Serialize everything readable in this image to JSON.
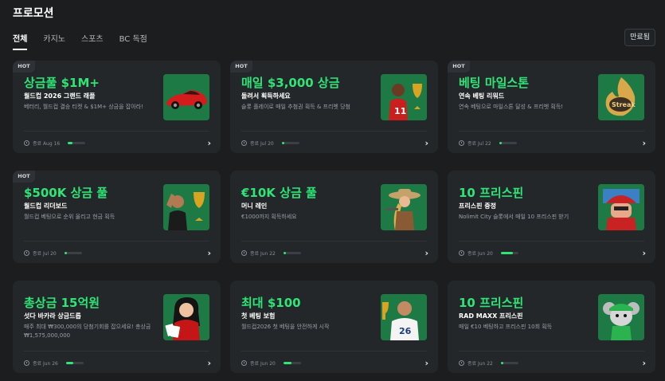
{
  "header": {
    "title": "프로모션"
  },
  "tabs": [
    {
      "label": "전체",
      "active": true
    },
    {
      "label": "카지노",
      "active": false
    },
    {
      "label": "스포츠",
      "active": false
    },
    {
      "label": "BC 독점",
      "active": false
    }
  ],
  "ended_button": "만료됨",
  "accent_color": "#2ee576",
  "cards": [
    {
      "hot": "HOT",
      "headline": "상금풀 $1M+",
      "subtitle": "월드컵 2026 그랜드 래플",
      "desc": "베터리, 월드컵 결승 티켓 & $1M+ 상금을 잡아라!",
      "end": "종료 Aug 16",
      "progress": 0.25,
      "icon": "red-sports-car-icon"
    },
    {
      "hot": "HOT",
      "headline": "매일 $3,000 상금",
      "subtitle": "돌려서 획득하세요",
      "desc": "슬롯 플레이로 매일 추첨권 획득 & 프리벳 당첨",
      "end": "종료 Jul 20",
      "progress": 0.15,
      "icon": "soccer-player-trophy-icon"
    },
    {
      "hot": "HOT",
      "headline": "베팅 마일스톤",
      "subtitle": "연속 베팅 리워드",
      "desc": "연속 베팅으로 마일스톤 달성 & 프리벳 획득!",
      "end": "종료 Jul 22",
      "progress": 0.15,
      "icon": "streak-badge-icon"
    },
    {
      "hot": "HOT",
      "headline": "$500K 상금 풀",
      "subtitle": "월드컵 리더보드",
      "desc": "월드컵 베팅으로 순위 올리고 현금 획득",
      "end": "종료 Jul 20",
      "progress": 0.15,
      "icon": "cheering-fan-trophy-icon"
    },
    {
      "hot": "",
      "headline": "€10K 상금 풀",
      "subtitle": "머니 레인",
      "desc": "€1000까지 획득하세요",
      "end": "종료 Jun 22",
      "progress": 0.15,
      "icon": "cowgirl-gunslinger-icon"
    },
    {
      "hot": "",
      "headline": "10 프리스핀",
      "subtitle": "프리스핀 증정",
      "desc": "Nolimit City 슬롯에서 매일 10 프리스핀 받기",
      "end": "종료 Jun 20",
      "progress": 0.7,
      "icon": "red-cap-character-icon"
    },
    {
      "hot": "",
      "headline": "총상금 15억원",
      "subtitle": "섯다 바카라 상금드롭",
      "desc": "매주 최대 ₩300,000의 당첨기회를 잡으세요! 총상금 ₩1,575,000,000",
      "end": "종료 Jun 26",
      "progress": 0.4,
      "icon": "card-dealer-woman-icon"
    },
    {
      "hot": "",
      "headline": "최대 $100",
      "subtitle": "첫 베팅 보험",
      "desc": "월드컵2026 첫 베팅을 안전하게 시작",
      "end": "종료 Jun 20",
      "progress": 0.45,
      "icon": "soccer-player-26-icon"
    },
    {
      "hot": "",
      "headline": "10 프리스핀",
      "subtitle": "RAD MAXX 프리스핀",
      "desc": "매일 €10 베팅하고 프리스핀 10회 획득",
      "end": "종료 Jun 22",
      "progress": 0.15,
      "icon": "mouse-mascot-icon"
    }
  ]
}
